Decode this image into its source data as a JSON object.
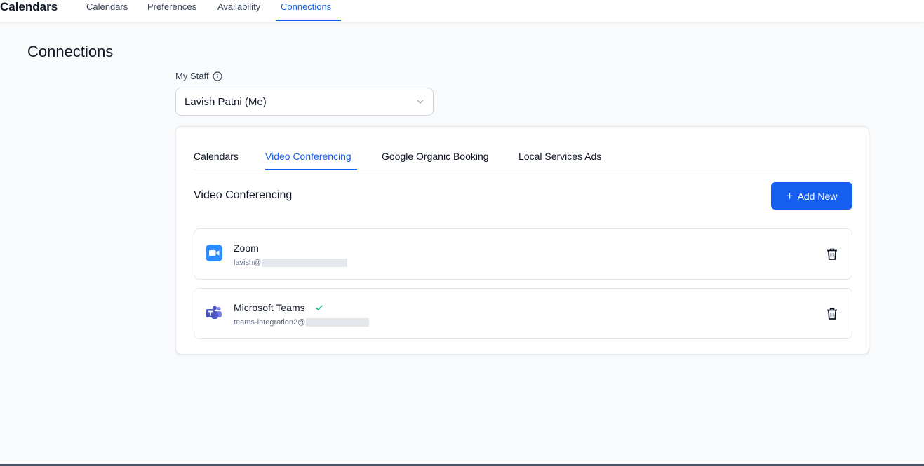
{
  "topnav": {
    "brand": "Calendars",
    "links": [
      "Calendars",
      "Preferences",
      "Availability",
      "Connections"
    ],
    "active_link": "Connections"
  },
  "page": {
    "title": "Connections"
  },
  "staff": {
    "label": "My Staff",
    "selected": "Lavish Patni (Me)"
  },
  "tabs": [
    "Calendars",
    "Video Conferencing",
    "Google Organic Booking",
    "Local Services Ads"
  ],
  "active_tab": "Video Conferencing",
  "section": {
    "title": "Video Conferencing",
    "add_button": "Add New"
  },
  "connections": [
    {
      "name": "Zoom",
      "email": "lavish@",
      "icon": "zoom-icon",
      "verified": false
    },
    {
      "name": "Microsoft Teams",
      "email": "teams-integration2@",
      "icon": "microsoft-teams-icon",
      "verified": true
    }
  ],
  "colors": {
    "accent": "#155eef",
    "zoom": "#2d8cff",
    "teams": "#4b53bc",
    "verified": "#12b76a"
  }
}
